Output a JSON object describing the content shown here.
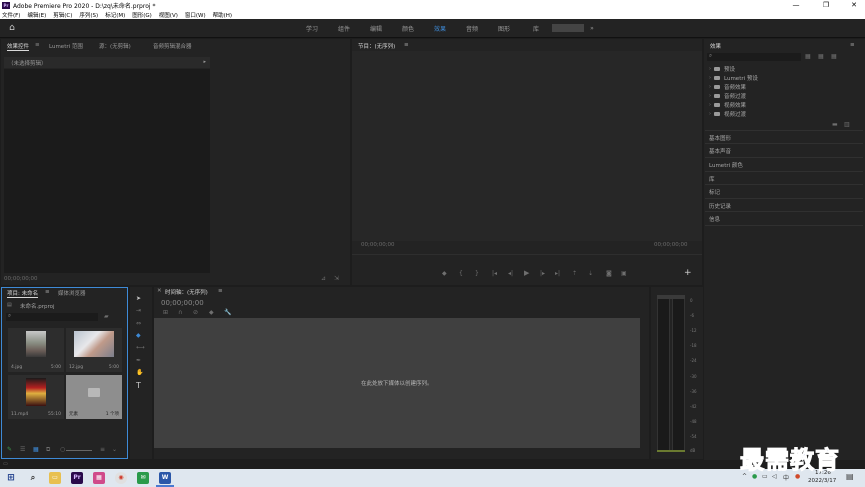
{
  "window": {
    "title": "Adobe Premiere Pro 2020 - D:\\zq\\未命名.prproj *",
    "app_badge": "Pr",
    "controls": [
      "—",
      "❐",
      "✕"
    ]
  },
  "menu": [
    "文件(F)",
    "编辑(E)",
    "剪辑(C)",
    "序列(S)",
    "标记(M)",
    "图形(G)",
    "视图(V)",
    "窗口(W)",
    "帮助(H)"
  ],
  "workspaces": {
    "items": [
      "学习",
      "组件",
      "编辑",
      "颜色",
      "效果",
      "音频",
      "图形",
      "库"
    ],
    "active": "效果",
    "more": "»"
  },
  "source_panel": {
    "tabs": [
      "效果控件",
      "Lumetri 范围",
      "源：(无剪辑)",
      "音频剪辑混合器"
    ],
    "no_clip": "（未选择剪辑）",
    "timecode": "00;00;00;00"
  },
  "program_panel": {
    "title": "节目：(无序列)",
    "timecode_left": "00;00;00;00",
    "timecode_right": "00;00;00;00"
  },
  "effects_panel": {
    "title": "效果",
    "tree": [
      "预设",
      "Lumetri 预设",
      "音频效果",
      "音频过渡",
      "视频效果",
      "视频过渡"
    ],
    "sections": [
      "基本图形",
      "基本声音",
      "Lumetri 颜色",
      "库",
      "标记",
      "历史记录",
      "信息"
    ]
  },
  "project_panel": {
    "tabs": [
      "项目: 未命名",
      "媒体浏览器"
    ],
    "file": "未命名.prproj",
    "items": [
      {
        "name": "4.jpg",
        "duration": "5:00"
      },
      {
        "name": "12.jpg",
        "duration": "5:00"
      },
      {
        "name": "11.mp4",
        "duration": "55:10"
      },
      {
        "name": "元素",
        "duration": "1 个项"
      }
    ]
  },
  "timeline_panel": {
    "title": "时间轴：(无序列)",
    "timecode": "00;00;00;00",
    "drop_hint": "在此处放下媒体以创建序列。"
  },
  "audio_meter": {
    "ticks": [
      "0",
      "-6",
      "-12",
      "-18",
      "-24",
      "-30",
      "-36",
      "-42",
      "-48",
      "-54",
      "dB"
    ]
  },
  "taskbar": {
    "time": "17:26",
    "date": "2022/3/17",
    "lang": "中"
  },
  "watermark": "最需教育",
  "colors": {
    "accent": "#3e8ad6",
    "panel_bg": "#232323",
    "project_border": "#3e8ad6"
  }
}
